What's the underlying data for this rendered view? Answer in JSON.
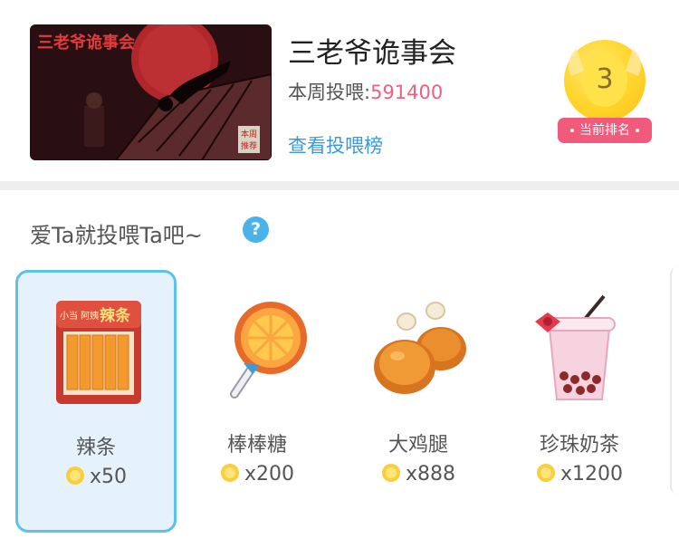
{
  "comic": {
    "title": "三老爷诡事会",
    "weekly_label": "本周投喂:",
    "weekly_value": "591400",
    "view_rank_link": "查看投喂榜",
    "cover_title": "三老爷诡事会",
    "cover_stamp": [
      "本周",
      "推荐"
    ]
  },
  "rank": {
    "number": "3",
    "label": "当前排名",
    "colors": {
      "coin": "#ffd42a",
      "tag": "#f25a7b"
    }
  },
  "feed": {
    "title": "爱Ta就投喂Ta吧~",
    "help_icon": "?"
  },
  "gifts": [
    {
      "name": "辣条",
      "price": "x50",
      "icon": "latiao-snack-icon",
      "selected": true,
      "pack_text": "辣条",
      "pack_brand": "小当 阿姨"
    },
    {
      "name": "棒棒糖",
      "price": "x200",
      "icon": "lollipop-icon",
      "selected": false
    },
    {
      "name": "大鸡腿",
      "price": "x888",
      "icon": "chicken-leg-icon",
      "selected": false
    },
    {
      "name": "珍珠奶茶",
      "price": "x1200",
      "icon": "bubble-tea-icon",
      "selected": false
    }
  ],
  "colors": {
    "accent_link": "#3a9ad9",
    "accent_number": "#ec5f7e",
    "selected_border": "#5bc3e8",
    "selected_bg": "#e6f2fb"
  }
}
